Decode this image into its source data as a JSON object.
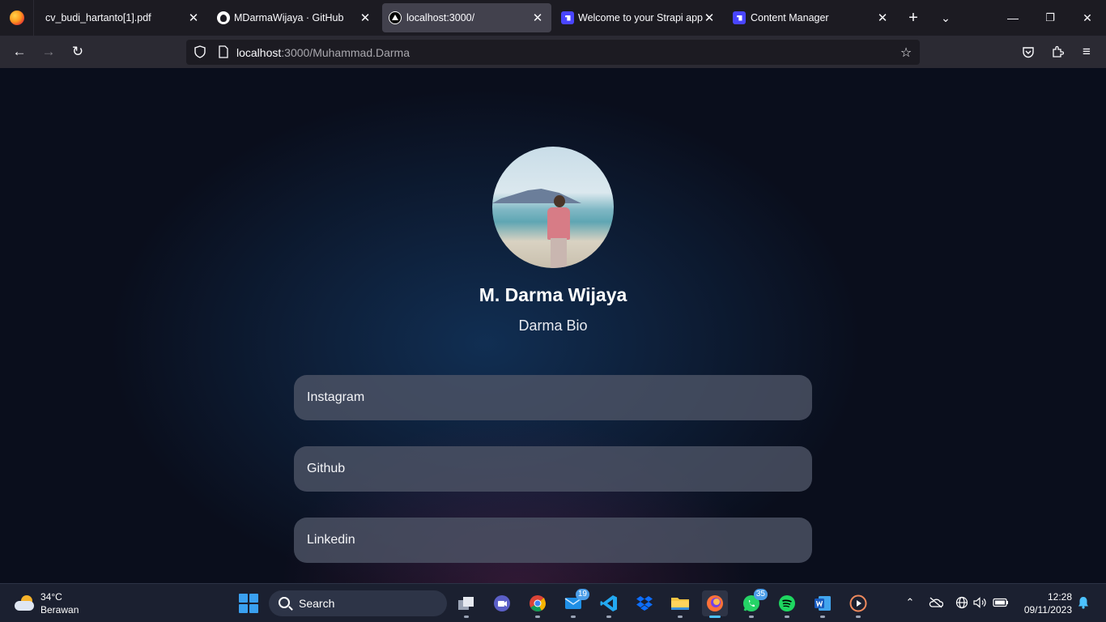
{
  "browser": {
    "tabs": [
      {
        "title": "cv_budi_hartanto[1].pdf",
        "icon": "pdf-icon",
        "active": false
      },
      {
        "title": "MDarmaWijaya · GitHub",
        "icon": "github-icon",
        "active": false
      },
      {
        "title": "localhost:3000/",
        "icon": "nextjs-icon",
        "active": true
      },
      {
        "title": "Welcome to your Strapi app",
        "icon": "strapi-icon",
        "active": false
      },
      {
        "title": "Content Manager",
        "icon": "strapi-icon",
        "active": false
      }
    ],
    "url": {
      "host": "localhost",
      "path": ":3000/Muhammad.Darma"
    }
  },
  "profile": {
    "name": "M. Darma Wijaya",
    "bio": "Darma Bio",
    "avatar": "profile-photo"
  },
  "links": [
    {
      "label": "Instagram"
    },
    {
      "label": "Github"
    },
    {
      "label": "Linkedin"
    }
  ],
  "taskbar": {
    "weather": {
      "temp": "34°C",
      "condition": "Berawan"
    },
    "search_label": "Search",
    "apps": [
      {
        "name": "task-view-icon"
      },
      {
        "name": "teams-icon"
      },
      {
        "name": "chrome-icon"
      },
      {
        "name": "mail-icon",
        "badge": "19"
      },
      {
        "name": "vscode-icon"
      },
      {
        "name": "dropbox-icon"
      },
      {
        "name": "file-explorer-icon"
      },
      {
        "name": "firefox-icon",
        "active": true
      },
      {
        "name": "whatsapp-icon",
        "badge": "35"
      },
      {
        "name": "spotify-icon"
      },
      {
        "name": "word-icon"
      },
      {
        "name": "media-player-icon"
      }
    ],
    "time": "12:28",
    "date": "09/11/2023"
  },
  "colors": {
    "page_bg": "#0a0e1c",
    "card_bg": "#505668",
    "tab_active": "#42414d",
    "taskbar_bg": "#1b2030"
  }
}
